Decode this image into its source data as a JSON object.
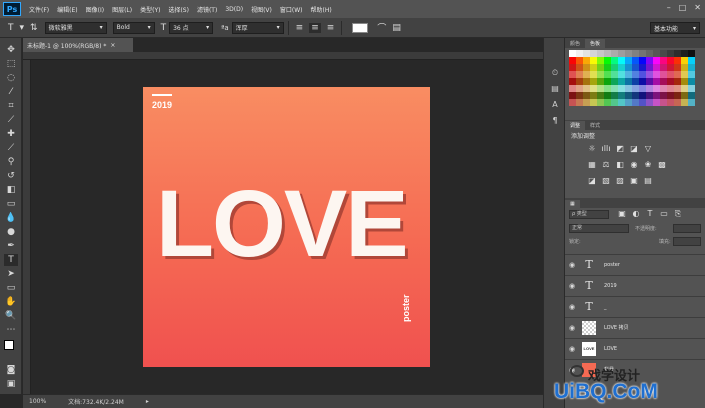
{
  "app": {
    "logo": "Ps"
  },
  "menu": [
    "文件(F)",
    "编辑(E)",
    "图像(I)",
    "图层(L)",
    "类型(Y)",
    "选择(S)",
    "滤镜(T)",
    "3D(D)",
    "视图(V)",
    "窗口(W)",
    "帮助(H)"
  ],
  "options": {
    "font_family": "微软雅黑",
    "font_style": "Bold",
    "font_size": "36 点",
    "antialias": "浑厚",
    "workspace": "基本功能"
  },
  "document": {
    "tab_title": "未标题-1 @ 100%(RGB/8) *",
    "zoom": "100%",
    "doc_info": "文档:732.4K/2.24M"
  },
  "poster": {
    "year": "2019",
    "headline": "LOVE",
    "tag": "poster",
    "colors": {
      "top": "#f98d62",
      "bottom": "#f0514f",
      "text": "#fdf6f1"
    }
  },
  "panels": {
    "color_tabs": [
      "颜色",
      "色板"
    ],
    "adjust_tabs": [
      "调整",
      "样式"
    ],
    "adjust_title": "添加调整",
    "layer_filter": "ρ 类型",
    "blend_mode": "正常",
    "opacity_label": "不透明度:",
    "lock_label": "锁定:",
    "fill_label": "填充:",
    "layers": [
      {
        "name": "poster",
        "thumb": "T"
      },
      {
        "name": "2019",
        "thumb": "T"
      },
      {
        "name": "_",
        "thumb": "T"
      },
      {
        "name": "LOVE 拷贝",
        "thumb": ""
      },
      {
        "name": "LOVE",
        "thumb": "LOVE"
      },
      {
        "name": "背景",
        "thumb": ""
      }
    ]
  },
  "watermark": {
    "line1": "戏学设计",
    "brand": "UiBQ.CoM"
  }
}
